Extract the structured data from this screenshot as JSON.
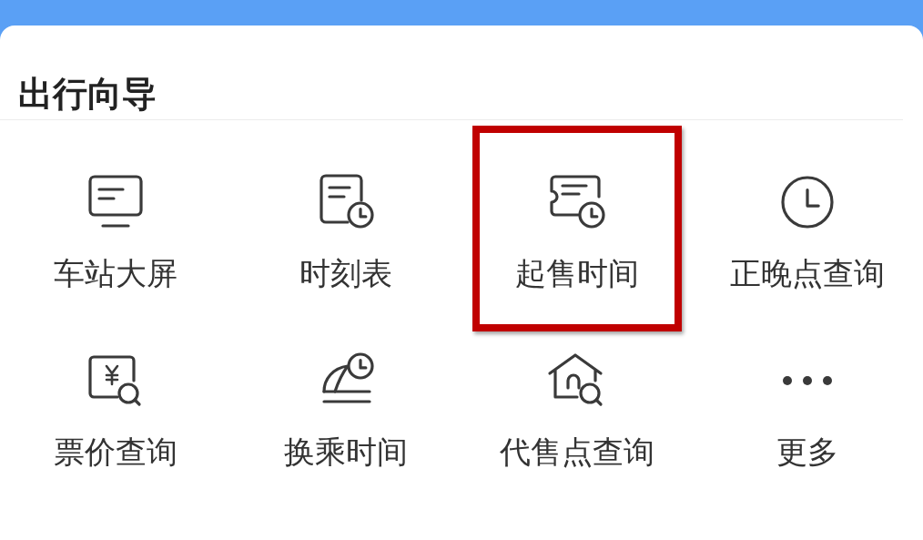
{
  "section": {
    "title": "出行向导"
  },
  "items": [
    {
      "kind": "screen",
      "label": "车站大屏",
      "highlighted": false
    },
    {
      "kind": "timetable",
      "label": "时刻表",
      "highlighted": false
    },
    {
      "kind": "ticket-clock",
      "label": "起售时间",
      "highlighted": true
    },
    {
      "kind": "clock",
      "label": "正晚点查询",
      "highlighted": false
    },
    {
      "kind": "price-search",
      "label": "票价查询",
      "highlighted": false
    },
    {
      "kind": "transfer",
      "label": "换乘时间",
      "highlighted": false
    },
    {
      "kind": "house-search",
      "label": "代售点查询",
      "highlighted": false
    },
    {
      "kind": "more",
      "label": "更多",
      "highlighted": false
    }
  ]
}
